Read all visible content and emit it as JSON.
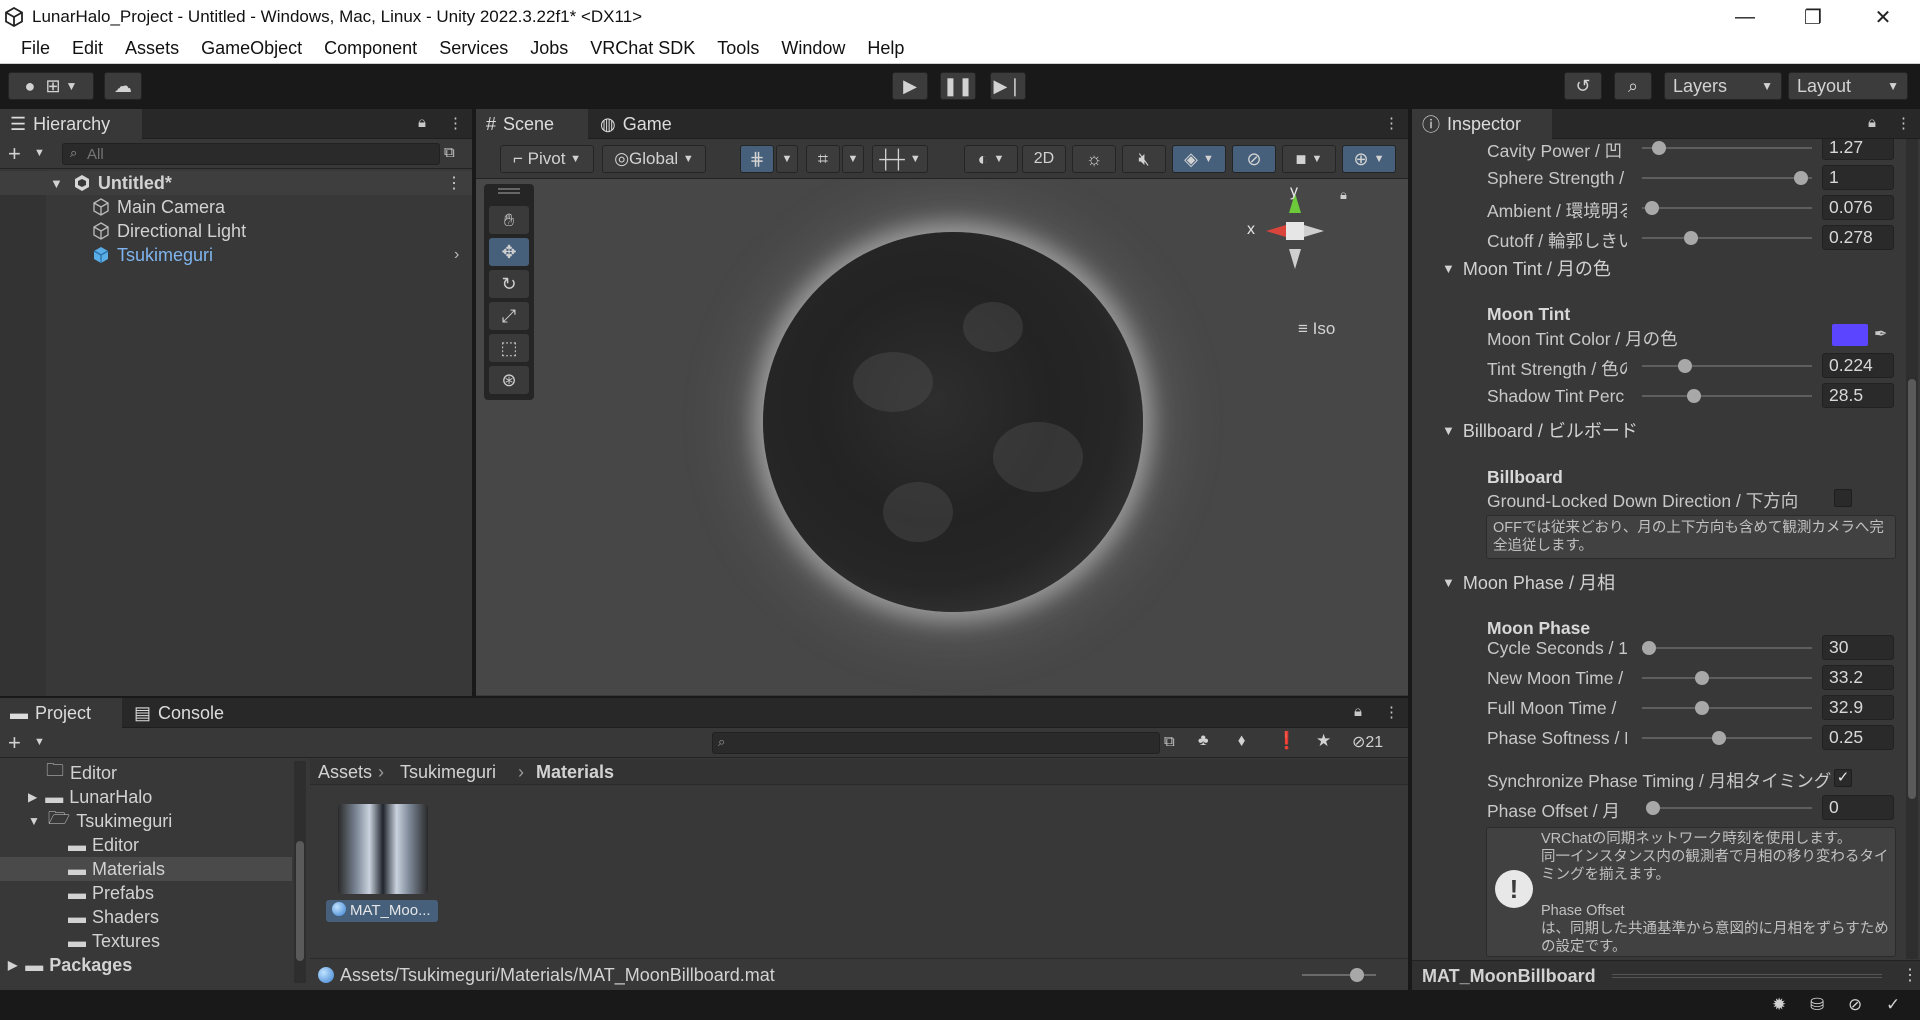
{
  "window": {
    "title": "LunarHalo_Project - Untitled - Windows, Mac, Linux - Unity 2022.3.22f1* <DX11>",
    "minimize": "—",
    "maximize": "❐",
    "close": "✕"
  },
  "menu": [
    "File",
    "Edit",
    "Assets",
    "GameObject",
    "Component",
    "Services",
    "Jobs",
    "VRChat SDK",
    "Tools",
    "Window",
    "Help"
  ],
  "toolbar": {
    "layers_label": "Layers",
    "layout_label": "Layout"
  },
  "hierarchy": {
    "tab": "Hierarchy",
    "search_placeholder": "All",
    "scene": "Untitled*",
    "items": [
      "Main Camera",
      "Directional Light",
      "Tsukimeguri"
    ]
  },
  "scene": {
    "tab_scene": "Scene",
    "tab_game": "Game",
    "pivot": "Pivot",
    "global": "Global",
    "mode_2d": "2D",
    "gizmo_y": "y",
    "gizmo_x": "x",
    "iso": "Iso"
  },
  "project": {
    "tab_project": "Project",
    "tab_console": "Console",
    "hidden_count": "21",
    "tree": [
      "Editor",
      "LunarHalo",
      "Tsukimeguri",
      "Editor",
      "Materials",
      "Prefabs",
      "Shaders",
      "Textures",
      "Packages"
    ],
    "breadcrumb": [
      "Assets",
      "Tsukimeguri",
      "Materials"
    ],
    "asset_name": "MAT_Moo...",
    "path": "Assets/Tsukimeguri/Materials/MAT_MoonBillboard.mat"
  },
  "inspector": {
    "tab": "Inspector",
    "footer_title": "MAT_MoonBillboard",
    "rows_top": [
      {
        "label": "Cavity Power / 凹",
        "value": "1.27",
        "knob": 0.06
      },
      {
        "label": "Sphere Strength /",
        "value": "1",
        "knob": 0.94
      },
      {
        "label": "Ambient / 環境明る",
        "value": "0.076",
        "knob": 0.02
      },
      {
        "label": "Cutoff / 輪郭しきい",
        "value": "0.278",
        "knob": 0.26
      }
    ],
    "moon_tint": {
      "foldout": "Moon Tint / 月の色",
      "header": "Moon Tint",
      "color_label": "Moon Tint Color / 月の色",
      "color": "#5b45ff",
      "rows": [
        {
          "label": "Tint Strength / 色の",
          "value": "0.224",
          "knob": 0.22
        },
        {
          "label": "Shadow Tint Perc",
          "value": "28.5",
          "knob": 0.28
        }
      ]
    },
    "billboard": {
      "foldout": "Billboard / ビルボード",
      "header": "Billboard",
      "toggle_label": "Ground-Locked Down Direction / 下方向",
      "help": "OFFでは従来どおり、月の上下方向も含めて観測カメラへ完全追従します。"
    },
    "moon_phase": {
      "foldout": "Moon Phase / 月相",
      "header": "Moon Phase",
      "rows": [
        {
          "label": "Cycle Seconds / 1",
          "value": "30",
          "knob": 0.0
        },
        {
          "label": "New Moon Time /",
          "value": "33.2",
          "knob": 0.33
        },
        {
          "label": "Full Moon Time / ",
          "value": "32.9",
          "knob": 0.33
        },
        {
          "label": "Phase Softness / E",
          "value": "0.25",
          "knob": 0.43
        }
      ],
      "sync_label": "Synchronize Phase Timing / 月相タイミング",
      "offset_label": "Phase Offset / 月相",
      "offset_value": "0",
      "help_lines": [
        "VRChatの同期ネットワーク時刻を使用します。",
        "同一インスタンス内の観測者で月相の移り変わるタイミングを揃えます。",
        "",
        "Phase Offset",
        "は、同期した共通基準から意図的に月相をずらすための設定です。"
      ]
    }
  }
}
